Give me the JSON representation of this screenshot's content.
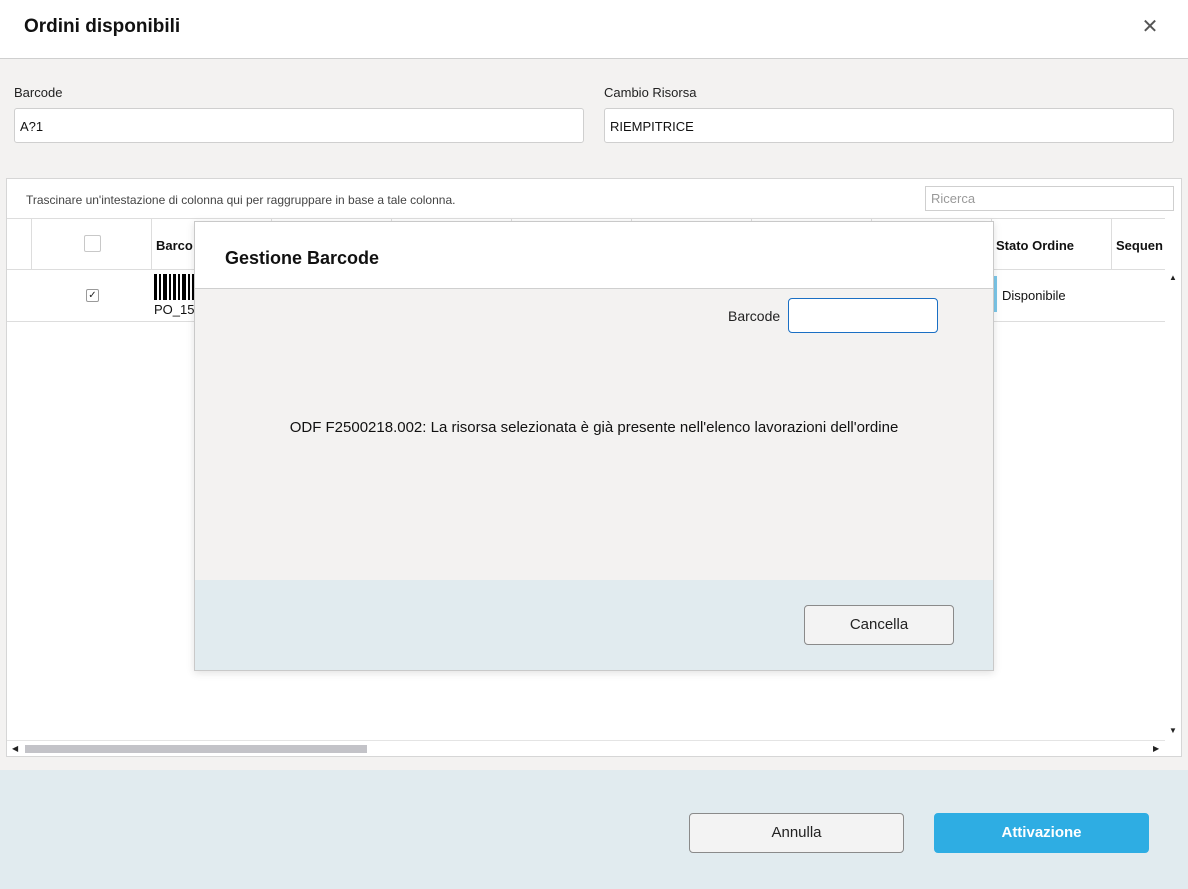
{
  "window": {
    "title": "Ordini disponibili",
    "close_glyph": "✕"
  },
  "form": {
    "barcode": {
      "label": "Barcode",
      "value": "A?1"
    },
    "cambio_risorsa": {
      "label": "Cambio Risorsa",
      "value": "RIEMPITRICE"
    }
  },
  "grid": {
    "group_hint": "Trascinare un'intestazione di colonna qui per raggruppare in base a tale colonna.",
    "search_placeholder": "Ricerca",
    "columns": {
      "barcode": "Barco",
      "stato_ordine": "Stato Ordine",
      "sequenza": "Sequen"
    },
    "rows": [
      {
        "checked": "✓",
        "barcode_text": "PO_15",
        "stato": "Disponibile"
      }
    ]
  },
  "footer": {
    "cancel_label": "Annulla",
    "activate_label": "Attivazione"
  },
  "modal": {
    "title": "Gestione Barcode",
    "barcode_label": "Barcode",
    "barcode_value": "",
    "message": "ODF F2500218.002: La risorsa selezionata è già presente nell'elenco lavorazioni dell'ordine",
    "cancel_label": "Cancella"
  },
  "colors": {
    "accent": "#2eade3",
    "footer_bg": "#e1ebef",
    "modal_input_border": "#1a6fc4"
  }
}
